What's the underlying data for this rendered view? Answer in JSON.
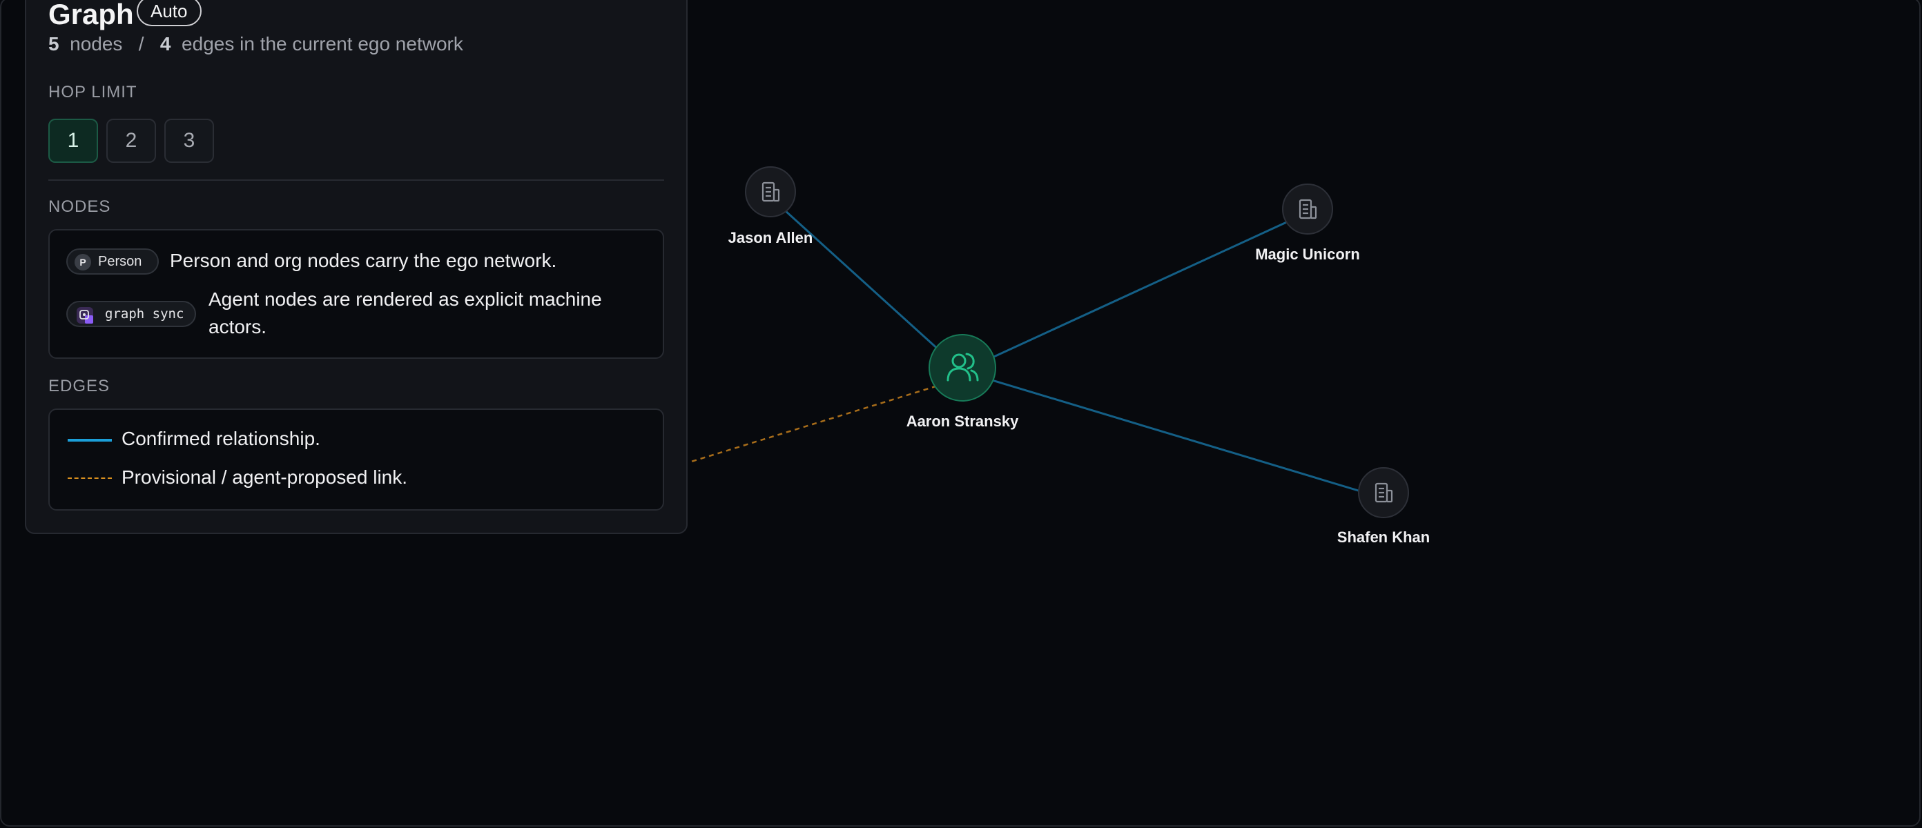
{
  "panel": {
    "title": "Graph",
    "mode_badge": "Auto",
    "stats": {
      "node_count": "5",
      "nodes_word": "nodes",
      "separator": "/",
      "edge_count": "4",
      "edges_text": "edges in the current ego network"
    },
    "hop_limit": {
      "label": "HOP LIMIT",
      "options": [
        "1",
        "2",
        "3"
      ],
      "selected": "1"
    },
    "nodes_section": {
      "label": "NODES",
      "person_chip": {
        "initial": "P",
        "label": "Person"
      },
      "person_desc": "Person and org nodes carry the ego network.",
      "agent_chip": {
        "label": "graph sync"
      },
      "agent_desc": "Agent nodes are rendered as explicit machine actors."
    },
    "edges_section": {
      "label": "EDGES",
      "confirmed": "Confirmed relationship.",
      "provisional": "Provisional / agent-proposed link."
    }
  },
  "graph": {
    "nodes": [
      {
        "id": "aaron",
        "label": "Aaron Stransky",
        "kind": "person",
        "icon": "people-icon",
        "ego": true
      },
      {
        "id": "jason",
        "label": "Jason Allen",
        "kind": "org",
        "icon": "building-icon"
      },
      {
        "id": "magic",
        "label": "Magic Unicorn",
        "kind": "org",
        "icon": "building-icon"
      },
      {
        "id": "shafen",
        "label": "Shafen Khan",
        "kind": "org",
        "icon": "building-icon"
      }
    ],
    "edges": [
      {
        "from": "aaron",
        "to": "jason",
        "type": "confirmed"
      },
      {
        "from": "aaron",
        "to": "magic",
        "type": "confirmed"
      },
      {
        "from": "aaron",
        "to": "shafen",
        "type": "confirmed"
      },
      {
        "from": "aaron",
        "to": "offscreen",
        "type": "provisional"
      }
    ]
  },
  "colors": {
    "confirmed_edge": "#1b9fd8",
    "provisional_edge": "#d9901f",
    "ego_node": "#22c08a"
  }
}
